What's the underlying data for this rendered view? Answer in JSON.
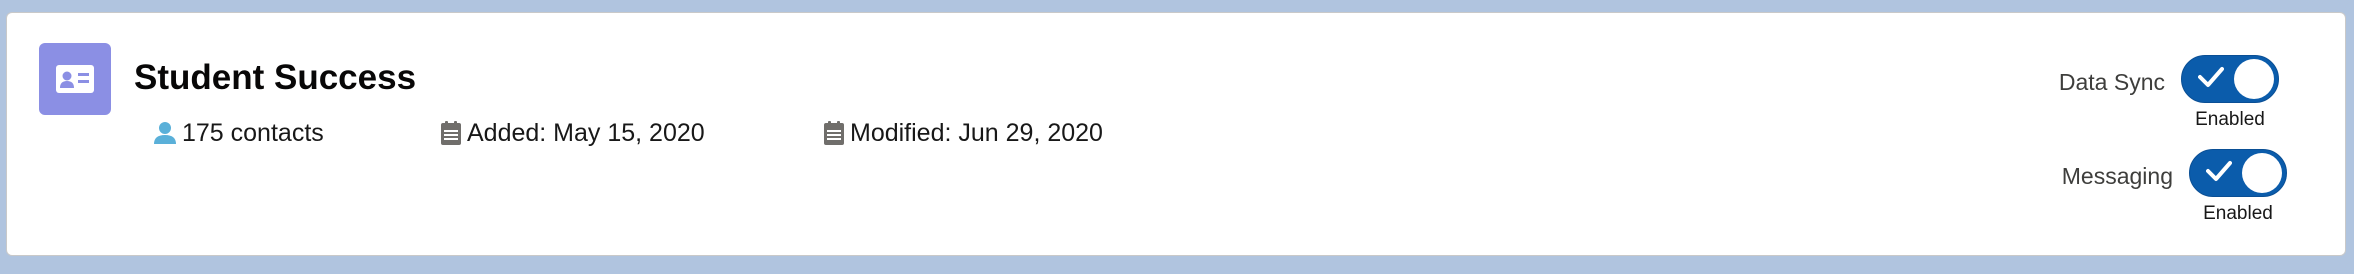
{
  "segment": {
    "title": "Student Success",
    "contacts": "175 contacts",
    "added": "Added: May 15, 2020",
    "modified": "Modified: Jun 29, 2020"
  },
  "toggles": {
    "data_sync": {
      "label": "Data Sync",
      "status": "Enabled",
      "enabled": true
    },
    "messaging": {
      "label": "Messaging",
      "status": "Enabled",
      "enabled": true
    }
  },
  "colors": {
    "icon_tile": "#8b8fe4",
    "toggle_on": "#0b5cab",
    "contact_icon": "#5ab0d9",
    "calendar_icon": "#706e6b",
    "page_background": "#b0c4df"
  },
  "icons": {
    "segment": "contact-card-icon",
    "contacts": "user-icon",
    "added": "calendar-icon",
    "modified": "calendar-icon",
    "toggle": "check-icon"
  }
}
